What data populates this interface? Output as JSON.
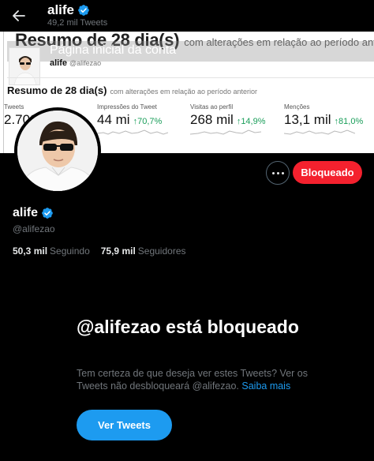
{
  "header": {
    "name": "alife",
    "tweet_count": "49,2 mil Tweets"
  },
  "banner": {
    "ghost_title": "Resumo de 28 dia(s)",
    "ghost_subtitle": "com alterações em relação ao período anterior",
    "overlay_text": "Página inicial da conta",
    "name": "alife",
    "handle": "@alifezao",
    "summary_title": "Resumo de 28 dia(s)",
    "summary_subtitle": "com alterações em relação ao período anterior",
    "stats": [
      {
        "label": "Tweets",
        "value": "2.702",
        "change": ""
      },
      {
        "label": "Impressões do Tweet",
        "value": "44 mi",
        "change": "↑70,7%"
      },
      {
        "label": "Visitas ao perfil",
        "value": "268 mil",
        "change": "↑14,9%"
      },
      {
        "label": "Menções",
        "value": "13,1 mil",
        "change": "↑81,0%"
      }
    ]
  },
  "actions": {
    "blocked_label": "Bloqueado"
  },
  "profile": {
    "name": "alife",
    "handle": "@alifezao",
    "following_count": "50,3 mil",
    "following_label": "Seguindo",
    "followers_count": "75,9 mil",
    "followers_label": "Seguidores"
  },
  "blocked": {
    "title": "@alifezao está bloqueado",
    "text": "Tem certeza de que deseja ver estes Tweets? Ver os Tweets não desbloqueará @alifezao.",
    "link": "Saiba mais",
    "button_label": "Ver Tweets"
  },
  "colors": {
    "accent": "#1d9bf0",
    "danger": "#f4212e",
    "positive_change": "#1a9e5a"
  },
  "icons": [
    "back-arrow-icon",
    "verified-badge-icon",
    "more-options-icon"
  ]
}
